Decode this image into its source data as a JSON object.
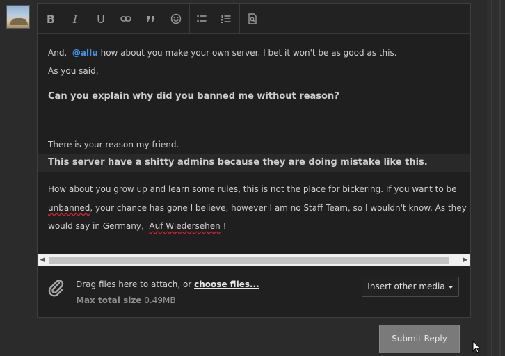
{
  "toolbar": {
    "buttons": [
      {
        "name": "bold-button",
        "label": "B"
      },
      {
        "name": "italic-button",
        "label": "I"
      },
      {
        "name": "underline-button",
        "label": "U"
      },
      {
        "name": "link-button",
        "icon": "link-icon"
      },
      {
        "name": "quote-button",
        "icon": "quote-icon"
      },
      {
        "name": "smilie-button",
        "icon": "smile-icon"
      },
      {
        "name": "bullet-list-button",
        "icon": "bullet-list-icon"
      },
      {
        "name": "numbered-list-button",
        "icon": "numbered-list-icon"
      },
      {
        "name": "preview-button",
        "icon": "preview-icon"
      }
    ]
  },
  "content": {
    "line1_prefix": "And,",
    "mention": "@allu",
    "line1_suffix": "how about you make your own server. I bet it won't be as good as this.",
    "line2": "As you said,",
    "line3": "Can you explain why did you banned me without reason?",
    "line4": "There is your reason my friend.",
    "line5": "This server have a shitty admins because they are doing mistake like this.",
    "line6": "How about you grow up and learn some rules, this is not the place for bickering. If you want to be",
    "line7_word": "unbanned",
    "line7_rest": ", your chance has gone I believe, however I am no Staff Team, so I wouldn't know. As they",
    "line8_prefix": "would say in Germany,",
    "line8_word": "Auf Wiedersehen",
    "line8_suffix": "!"
  },
  "attach": {
    "drag_text": "Drag files here to attach, or",
    "choose_link": "choose files...",
    "max_label": "Max total size",
    "max_value": "0.49MB",
    "insert_media": "Insert other media"
  },
  "submit_label": "Submit Reply",
  "colors": {
    "mention": "#3f97e4",
    "submit": "#7a7a7a",
    "background": "#2b2b2b"
  }
}
